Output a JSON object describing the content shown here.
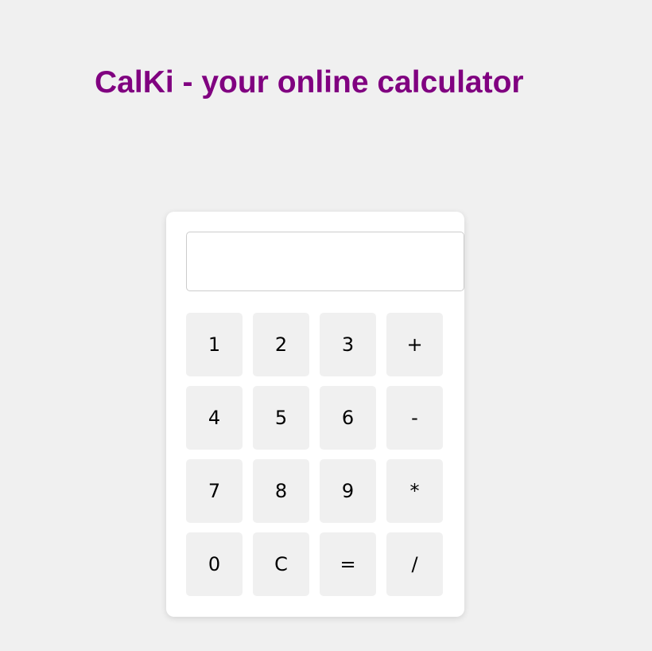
{
  "colors": {
    "page_background": "#f0f0f0",
    "title": "#800080",
    "panel": "#ffffff",
    "key_background": "#f0f0f0",
    "key_text": "#000000"
  },
  "header": {
    "title": "CalKi - your online calculator"
  },
  "calculator": {
    "display": {
      "value": "",
      "placeholder": ""
    },
    "keys": [
      {
        "label": "1",
        "name": "key-1"
      },
      {
        "label": "2",
        "name": "key-2"
      },
      {
        "label": "3",
        "name": "key-3"
      },
      {
        "label": "+",
        "name": "key-plus"
      },
      {
        "label": "4",
        "name": "key-4"
      },
      {
        "label": "5",
        "name": "key-5"
      },
      {
        "label": "6",
        "name": "key-6"
      },
      {
        "label": "-",
        "name": "key-minus"
      },
      {
        "label": "7",
        "name": "key-7"
      },
      {
        "label": "8",
        "name": "key-8"
      },
      {
        "label": "9",
        "name": "key-9"
      },
      {
        "label": "*",
        "name": "key-multiply"
      },
      {
        "label": "0",
        "name": "key-0"
      },
      {
        "label": "C",
        "name": "key-clear"
      },
      {
        "label": "=",
        "name": "key-equals"
      },
      {
        "label": "/",
        "name": "key-divide"
      }
    ]
  }
}
